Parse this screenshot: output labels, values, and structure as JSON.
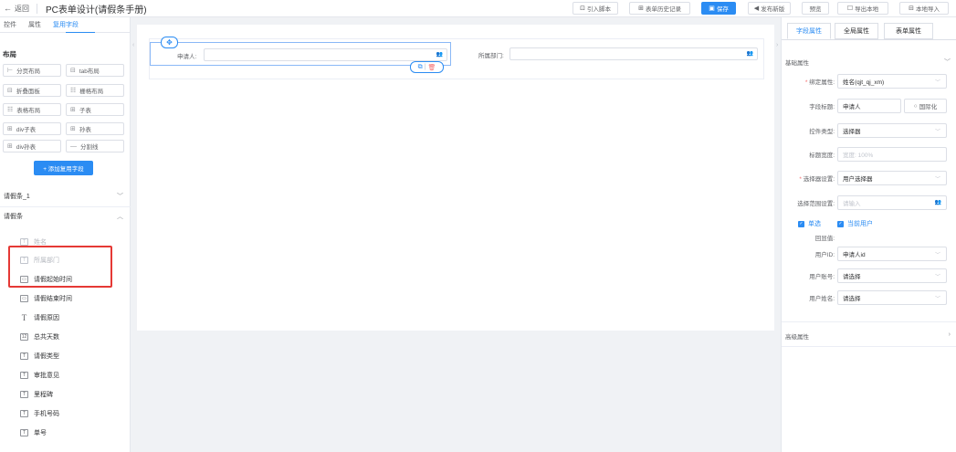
{
  "topbar": {
    "back": "返回",
    "title": "PC表单设计(请假条手册)",
    "buttons": {
      "import_script": "引入脚本",
      "history": "表单历史记录",
      "save": "保存",
      "publish": "发布新版",
      "preview": "预览",
      "export": "导出本地",
      "local_import": "本地导入"
    }
  },
  "left_panel": {
    "tabs": [
      "控件",
      "属性",
      "复用字段"
    ],
    "active_tab": "复用字段",
    "layout_title": "布局",
    "components": [
      {
        "label": "分页布局",
        "icon": "⊢"
      },
      {
        "label": "tab布局",
        "icon": "⊟"
      },
      {
        "label": "折叠面板",
        "icon": "⊟"
      },
      {
        "label": "栅格布局",
        "icon": "☷"
      },
      {
        "label": "表格布局",
        "icon": "☷"
      },
      {
        "label": "子表",
        "icon": "⊞"
      },
      {
        "label": "div子表",
        "icon": "⊞"
      },
      {
        "label": "孙表",
        "icon": "⊞"
      },
      {
        "label": "div孙表",
        "icon": "⊞"
      },
      {
        "label": "分割线",
        "icon": "—"
      }
    ],
    "add_reuse_button": "+ 添加复用字段",
    "groups": [
      {
        "label": "请假条_1",
        "expanded": false
      },
      {
        "label": "请假条",
        "expanded": true
      }
    ],
    "fields": [
      {
        "label": "姓名",
        "disabled": true
      },
      {
        "label": "所属部门",
        "disabled": true
      },
      {
        "label": "请假起始时间",
        "disabled": false
      },
      {
        "label": "请假结束时间",
        "disabled": false
      },
      {
        "label": "请假原因",
        "disabled": false
      },
      {
        "label": "总共天数",
        "disabled": false
      },
      {
        "label": "请假类型",
        "disabled": false
      },
      {
        "label": "审批意见",
        "disabled": false
      },
      {
        "label": "里程碑",
        "disabled": false
      },
      {
        "label": "手机号码",
        "disabled": false
      },
      {
        "label": "单号",
        "disabled": false
      }
    ]
  },
  "canvas": {
    "field1_label": "申请人:",
    "field2_label": "所属部门:"
  },
  "right_panel": {
    "tabs": [
      "字段属性",
      "全局属性",
      "表单属性"
    ],
    "active_tab": "字段属性",
    "basic_section": "基础属性",
    "advanced_section": "高级属性",
    "props": {
      "bind_attr_label": "绑定属性:",
      "bind_attr_value": "姓名(qjt_qj_xm)",
      "field_title_label": "字段标题:",
      "field_title_value": "申请人",
      "i18n_button": "国际化",
      "control_type_label": "控件类型:",
      "control_type_value": "选择器",
      "label_width_label": "标题宽度:",
      "label_width_placeholder": "宽度: 100%",
      "selector_setting_label": "选择器设置:",
      "selector_setting_value": "用户选择器",
      "selector_scope_label": "选择范围设置:",
      "selector_scope_placeholder": "请输入",
      "single_label": "单选",
      "current_user_label": "当前用户",
      "echo_label": "回显值:",
      "user_id_label": "用户ID:",
      "user_id_value": "申请人id",
      "user_account_label": "用户账号:",
      "user_account_placeholder": "请选择",
      "user_name_label": "用户姓名:",
      "user_name_placeholder": "请选择"
    }
  },
  "colors": {
    "accent": "#2b8cf3",
    "highlight_box": "#e53935"
  }
}
